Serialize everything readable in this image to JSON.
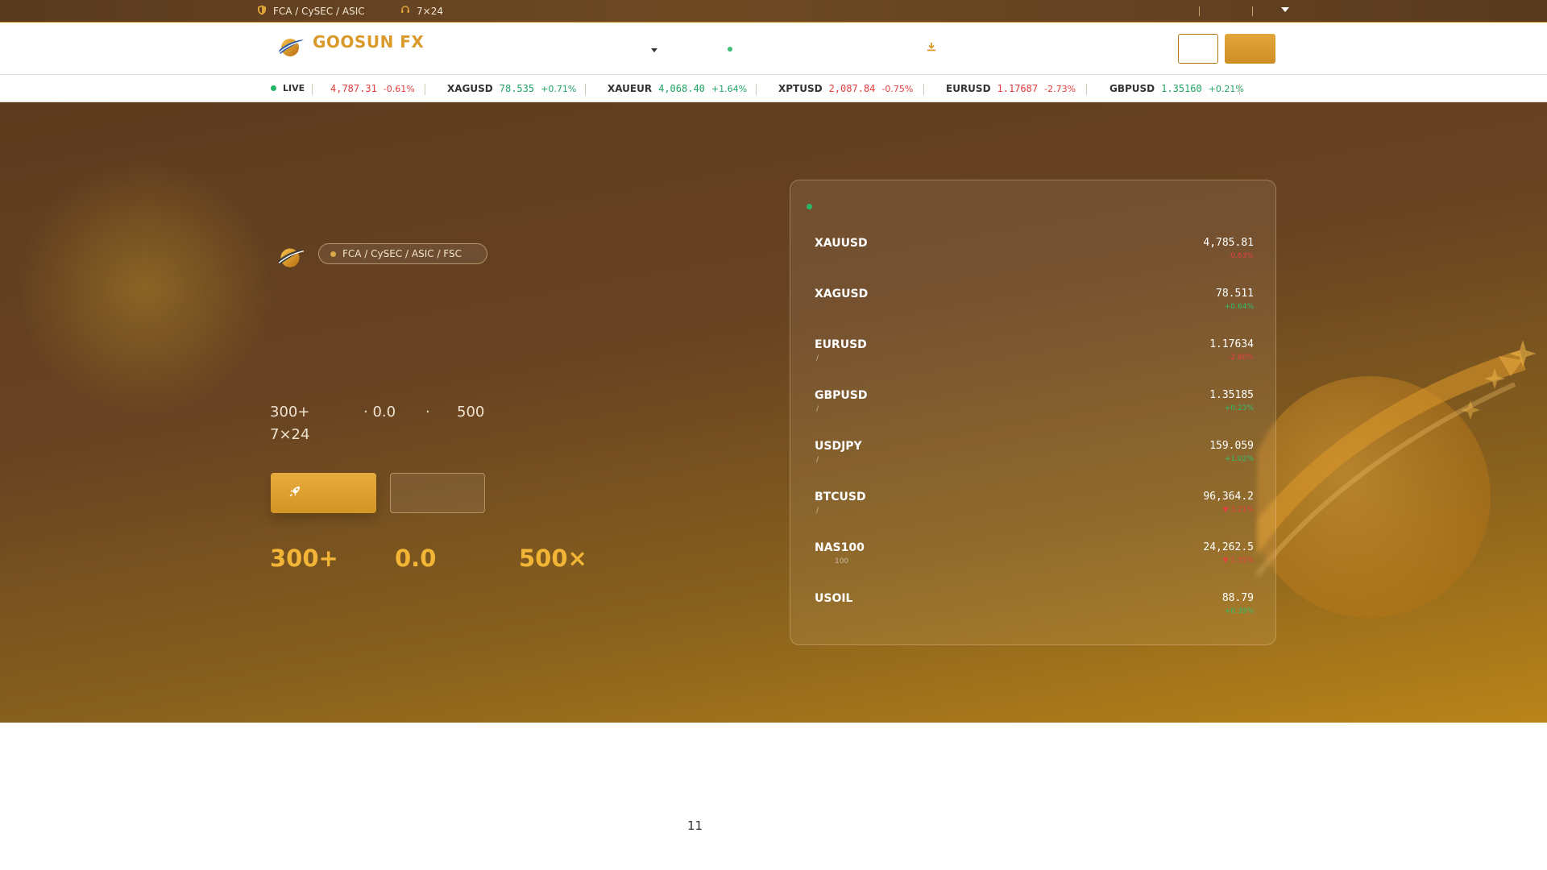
{
  "topbar": {
    "regulation": "FCA / CySEC / ASIC",
    "support": "7×24"
  },
  "header": {
    "brand": "GOOSUN FX"
  },
  "ticker": {
    "live_label": "LIVE",
    "items": [
      {
        "symbol": "",
        "price": "4,787.31",
        "change": "-0.61%",
        "direction": "down"
      },
      {
        "symbol": "XAGUSD",
        "price": "78.535",
        "change": "+0.71%",
        "direction": "up"
      },
      {
        "symbol": "XAUEUR",
        "price": "4,068.40",
        "change": "+1.64%",
        "direction": "up"
      },
      {
        "symbol": "XPTUSD",
        "price": "2,087.84",
        "change": "-0.75%",
        "direction": "down"
      },
      {
        "symbol": "EURUSD",
        "price": "1.17687",
        "change": "-2.73%",
        "direction": "down"
      },
      {
        "symbol": "GBPUSD",
        "price": "1.35160",
        "change": "+0.21%",
        "direction": "up"
      }
    ]
  },
  "hero": {
    "regulation_badge": "FCA / CySEC / ASIC / FSC",
    "features_line1": [
      "300+",
      "· 0.0",
      "·",
      "500"
    ],
    "features_line2": "7×24",
    "stats": [
      "300+",
      "0.0",
      "500×"
    ]
  },
  "quotes": {
    "rows": [
      {
        "symbol": "XAUUSD",
        "sub": "",
        "price": "4,785.81",
        "change": "-0.63%",
        "direction": "down"
      },
      {
        "symbol": "XAGUSD",
        "sub": "",
        "price": "78.511",
        "change": "+0.64%",
        "direction": "up"
      },
      {
        "symbol": "EURUSD",
        "sub": "/",
        "price": "1.17634",
        "change": "-2.80%",
        "direction": "down"
      },
      {
        "symbol": "GBPUSD",
        "sub": "/",
        "price": "1.35185",
        "change": "+0.23%",
        "direction": "up"
      },
      {
        "symbol": "USDJPY",
        "sub": "/",
        "price": "159.059",
        "change": "+1.02%",
        "direction": "up"
      },
      {
        "symbol": "BTCUSD",
        "sub": "/",
        "price": "96,364.2",
        "change": "▼ 3.21%",
        "direction": "down"
      },
      {
        "symbol": "NAS100",
        "sub": "100",
        "price": "24,262.5",
        "change": "▼ 1.35%",
        "direction": "down"
      },
      {
        "symbol": "USOIL",
        "sub": "",
        "price": "88.79",
        "change": "+0.39%",
        "direction": "up"
      }
    ]
  },
  "footer": {
    "number": "11"
  },
  "colors": {
    "accent": "#d99a2b",
    "up": "#1fa463",
    "down": "#e23b3b"
  }
}
